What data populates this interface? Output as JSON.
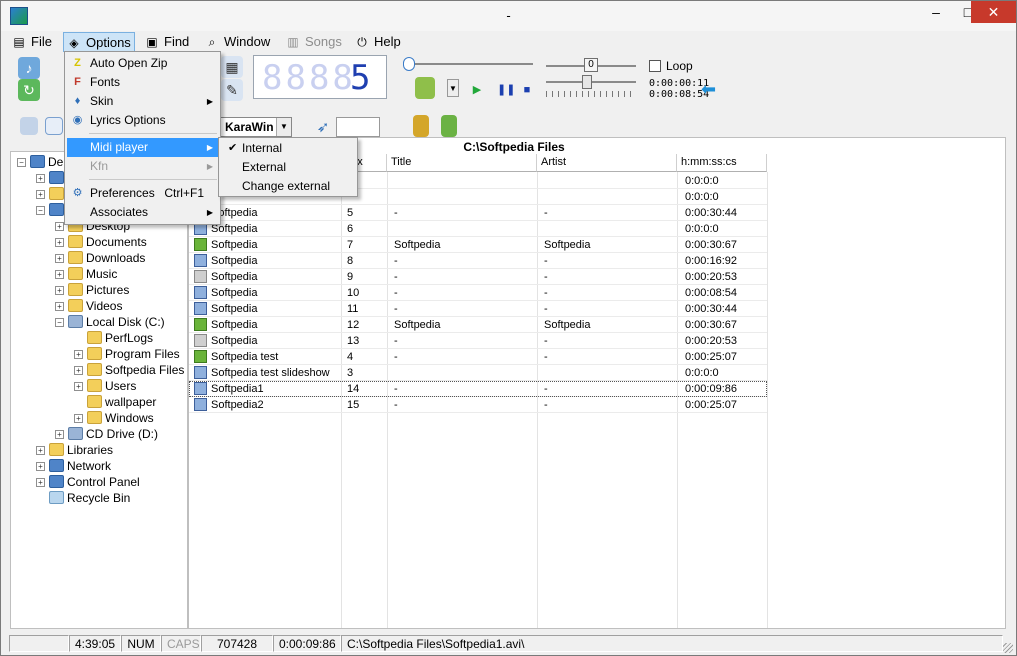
{
  "window": {
    "title": "-",
    "min_symbol": "–",
    "max_symbol": "□",
    "close_symbol": "✕"
  },
  "menubar": [
    {
      "label": "File",
      "icon": "file-icon"
    },
    {
      "label": "Options",
      "icon": "options-icon",
      "active": true
    },
    {
      "label": "Find",
      "icon": "find-icon"
    },
    {
      "label": "Window",
      "icon": "window-icon"
    },
    {
      "label": "Songs",
      "icon": "songs-icon",
      "disabled": true
    },
    {
      "label": "Help",
      "icon": "help-icon"
    }
  ],
  "lcd": {
    "dim_digits": "8888",
    "last_digit": "5"
  },
  "player": {
    "volume_value": "0",
    "time_elapsed": "0:00:00:11",
    "time_total": "0:00:08:54"
  },
  "loop": {
    "label": "Loop",
    "checked": false
  },
  "combo": {
    "value": "KaraWin"
  },
  "options_menu": {
    "items": [
      {
        "label": "Auto Open Zip",
        "icon": "zip-icon",
        "glyph": "Z"
      },
      {
        "label": "Fonts",
        "icon": "fonts-icon",
        "glyph": "F"
      },
      {
        "label": "Skin",
        "icon": "skin-icon",
        "glyph": "♦",
        "submenu": true
      },
      {
        "label": "Lyrics Options",
        "icon": "lyrics-options-icon",
        "glyph": "◉"
      },
      {
        "label": "Midi player",
        "icon": "",
        "glyph": "",
        "submenu": true,
        "highlighted": true
      },
      {
        "label": "Kfn",
        "icon": "",
        "glyph": "",
        "submenu": true,
        "disabled": true
      },
      {
        "label": "Preferences",
        "icon": "preferences-icon",
        "glyph": "⚙",
        "shortcut": "Ctrl+F1"
      },
      {
        "label": "Associates",
        "icon": "",
        "glyph": "",
        "submenu": true
      }
    ],
    "submenu_arrow": "▶"
  },
  "midi_submenu": {
    "items": [
      {
        "label": "Internal",
        "checked": true
      },
      {
        "label": "External",
        "checked": false
      },
      {
        "label": "Change external",
        "checked": false
      }
    ],
    "check_mark": "✔"
  },
  "tree": {
    "items": [
      {
        "label": "De",
        "indent": 0,
        "expander": "minus",
        "icon": "desktop-icon",
        "style": "blue"
      },
      {
        "label": "",
        "indent": 1,
        "expander": "plus",
        "icon": "cloud-icon",
        "style": "blue"
      },
      {
        "label": "",
        "indent": 1,
        "expander": "plus",
        "icon": "user-folder-icon",
        "style": "folder"
      },
      {
        "label": "",
        "indent": 1,
        "expander": "minus",
        "icon": "computer-icon",
        "style": "blue"
      },
      {
        "label": "Desktop",
        "indent": 2,
        "expander": "plus",
        "icon": "folder-icon",
        "style": "folder"
      },
      {
        "label": "Documents",
        "indent": 2,
        "expander": "plus",
        "icon": "folder-icon",
        "style": "folder"
      },
      {
        "label": "Downloads",
        "indent": 2,
        "expander": "plus",
        "icon": "folder-icon",
        "style": "folder"
      },
      {
        "label": "Music",
        "indent": 2,
        "expander": "plus",
        "icon": "folder-icon",
        "style": "folder"
      },
      {
        "label": "Pictures",
        "indent": 2,
        "expander": "plus",
        "icon": "folder-icon",
        "style": "folder"
      },
      {
        "label": "Videos",
        "indent": 2,
        "expander": "plus",
        "icon": "folder-icon",
        "style": "folder"
      },
      {
        "label": "Local Disk (C:)",
        "indent": 2,
        "expander": "minus",
        "icon": "drive-icon",
        "style": "drive"
      },
      {
        "label": "PerfLogs",
        "indent": 3,
        "expander": "none",
        "icon": "folder-icon",
        "style": "folder"
      },
      {
        "label": "Program Files",
        "indent": 3,
        "expander": "plus",
        "icon": "folder-icon",
        "style": "folder"
      },
      {
        "label": "Softpedia Files",
        "indent": 3,
        "expander": "plus",
        "icon": "folder-icon",
        "style": "folder"
      },
      {
        "label": "Users",
        "indent": 3,
        "expander": "plus",
        "icon": "folder-icon",
        "style": "folder"
      },
      {
        "label": "wallpaper",
        "indent": 3,
        "expander": "none",
        "icon": "folder-icon",
        "style": "folder"
      },
      {
        "label": "Windows",
        "indent": 3,
        "expander": "plus",
        "icon": "folder-icon",
        "style": "folder"
      },
      {
        "label": "CD Drive (D:)",
        "indent": 2,
        "expander": "plus",
        "icon": "cd-drive-icon",
        "style": "drive"
      },
      {
        "label": "Libraries",
        "indent": 1,
        "expander": "plus",
        "icon": "libraries-icon",
        "style": "folder"
      },
      {
        "label": "Network",
        "indent": 1,
        "expander": "plus",
        "icon": "network-icon",
        "style": "blue"
      },
      {
        "label": "Control Panel",
        "indent": 1,
        "expander": "plus",
        "icon": "control-panel-icon",
        "style": "blue"
      },
      {
        "label": "Recycle Bin",
        "indent": 1,
        "expander": "none",
        "icon": "recycle-bin-icon",
        "style": "bin"
      }
    ]
  },
  "list": {
    "path": "C:\\Softpedia Files",
    "columns": [
      "dex",
      "Title",
      "Artist",
      "h:mm:ss:cs"
    ],
    "rows": [
      {
        "name": "",
        "index": "",
        "title": "",
        "artist": "",
        "duration": "0:0:0:0",
        "icon": "video-file-icon",
        "style": "blue"
      },
      {
        "name": "",
        "index": "",
        "title": "",
        "artist": "",
        "duration": "0:0:0:0",
        "icon": "video-file-icon",
        "style": "blue"
      },
      {
        "name": "Softpedia",
        "index": "5",
        "title": "-",
        "artist": "-",
        "duration": "0:00:30:44",
        "icon": "video-file-icon",
        "style": "blue"
      },
      {
        "name": "Softpedia",
        "index": "6",
        "title": "",
        "artist": "",
        "duration": "0:0:0:0",
        "icon": "video-file-icon",
        "style": "blue"
      },
      {
        "name": "Softpedia",
        "index": "7",
        "title": "Softpedia",
        "artist": "Softpedia",
        "duration": "0:00:30:67",
        "icon": "karaoke-file-icon",
        "style": "green"
      },
      {
        "name": "Softpedia",
        "index": "8",
        "title": "-",
        "artist": "-",
        "duration": "0:00:16:92",
        "icon": "video-file-icon",
        "style": "blue"
      },
      {
        "name": "Softpedia",
        "index": "9",
        "title": "-",
        "artist": "-",
        "duration": "0:00:20:53",
        "icon": "midi-file-icon",
        "style": "gray"
      },
      {
        "name": "Softpedia",
        "index": "10",
        "title": "-",
        "artist": "-",
        "duration": "0:00:08:54",
        "icon": "video-file-icon",
        "style": "blue"
      },
      {
        "name": "Softpedia",
        "index": "11",
        "title": "-",
        "artist": "-",
        "duration": "0:00:30:44",
        "icon": "video-file-icon",
        "style": "blue"
      },
      {
        "name": "Softpedia",
        "index": "12",
        "title": "Softpedia",
        "artist": "Softpedia",
        "duration": "0:00:30:67",
        "icon": "karaoke-file-icon",
        "style": "green"
      },
      {
        "name": "Softpedia",
        "index": "13",
        "title": "-",
        "artist": "-",
        "duration": "0:00:20:53",
        "icon": "midi-file-icon",
        "style": "gray"
      },
      {
        "name": "Softpedia test",
        "index": "4",
        "title": "-",
        "artist": "-",
        "duration": "0:00:25:07",
        "icon": "karaoke-file-icon",
        "style": "green"
      },
      {
        "name": "Softpedia test slideshow",
        "index": "3",
        "title": "",
        "artist": "",
        "duration": "0:0:0:0",
        "icon": "video-file-icon",
        "style": "blue"
      },
      {
        "name": "Softpedia1",
        "index": "14",
        "title": "-",
        "artist": "-",
        "duration": "0:00:09:86",
        "icon": "video-file-icon",
        "style": "blue",
        "selected": true
      },
      {
        "name": "Softpedia2",
        "index": "15",
        "title": "-",
        "artist": "-",
        "duration": "0:00:25:07",
        "icon": "video-file-icon",
        "style": "blue"
      }
    ]
  },
  "status": {
    "clock": "4:39:05",
    "num": "NUM",
    "caps": "CAPS",
    "size": "707428",
    "duration": "0:00:09:86",
    "file_path": "C:\\Softpedia Files\\Softpedia1.avi\\"
  }
}
